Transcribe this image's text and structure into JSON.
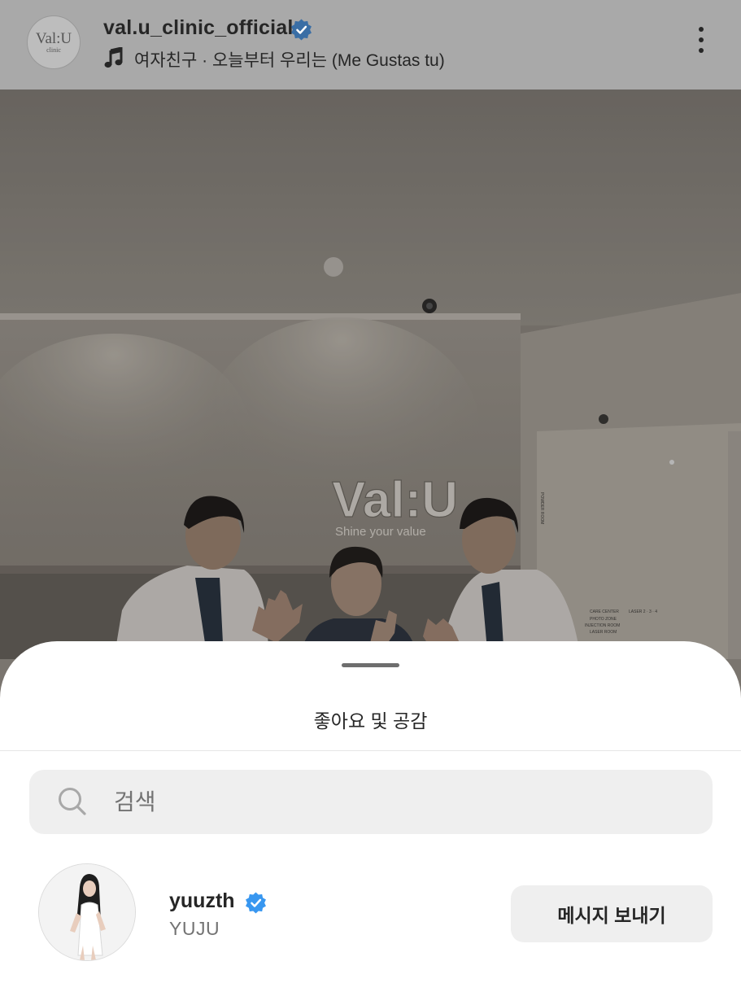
{
  "post_header": {
    "avatar_logo_main": "Val:U",
    "avatar_logo_sub": "clinic",
    "username": "val.u_clinic_official",
    "music_icon": "music-note-icon",
    "music_text": "여자친구 · 오늘부터 우리는 (Me Gustas tu)",
    "more_icon": "more-vertical-icon"
  },
  "photo": {
    "sign_main": "Val:U",
    "sign_sub": "Shine your value",
    "wall_text_1": "CARE CENTER",
    "wall_text_2": "PHOTO ZONE",
    "wall_text_3": "INJECTION ROOM",
    "wall_text_4": "LASER ROOM",
    "wall_text_5": "LASER 2 · 3 · 4",
    "wall_text_6": "POWDER ROOM"
  },
  "sheet": {
    "title": "좋아요 및 공감",
    "search": {
      "icon": "search-icon",
      "placeholder": "검색"
    },
    "users": [
      {
        "handle": "yuuzth",
        "name": "YUJU",
        "verified": true,
        "action_label": "메시지 보내기"
      }
    ]
  },
  "colors": {
    "verified_blue": "#3897f0",
    "text_primary": "#262626",
    "text_secondary": "#737373",
    "button_bg": "#efefef",
    "overlay_header": "#a9a9a9"
  }
}
